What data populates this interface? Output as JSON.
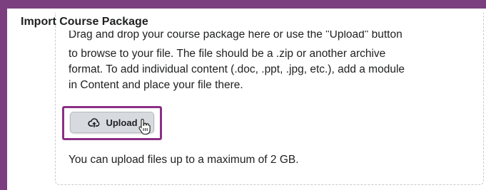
{
  "section": {
    "title": "Import Course Package"
  },
  "dropzone": {
    "instruction_lines": [
      "Drag and drop your course package here or use the \"Upload\" button",
      "to browse to your file. The file should be a .zip or another archive",
      "format. To add individual content (.doc, .ppt, .jpg, etc.), add a module",
      "in Content and place your file there."
    ],
    "upload_button_label": "Upload",
    "upload_icon": "cloud-upload-icon",
    "cursor_icon": "hand-pointer-icon",
    "size_limit_note": "You can upload files up to a maximum of 2 GB."
  },
  "colors": {
    "frame_accent": "#7b3f7f",
    "highlight_border": "#8b2f86",
    "button_background": "#d7dadf",
    "dashed_border": "#c8cacd",
    "text": "#202122"
  }
}
